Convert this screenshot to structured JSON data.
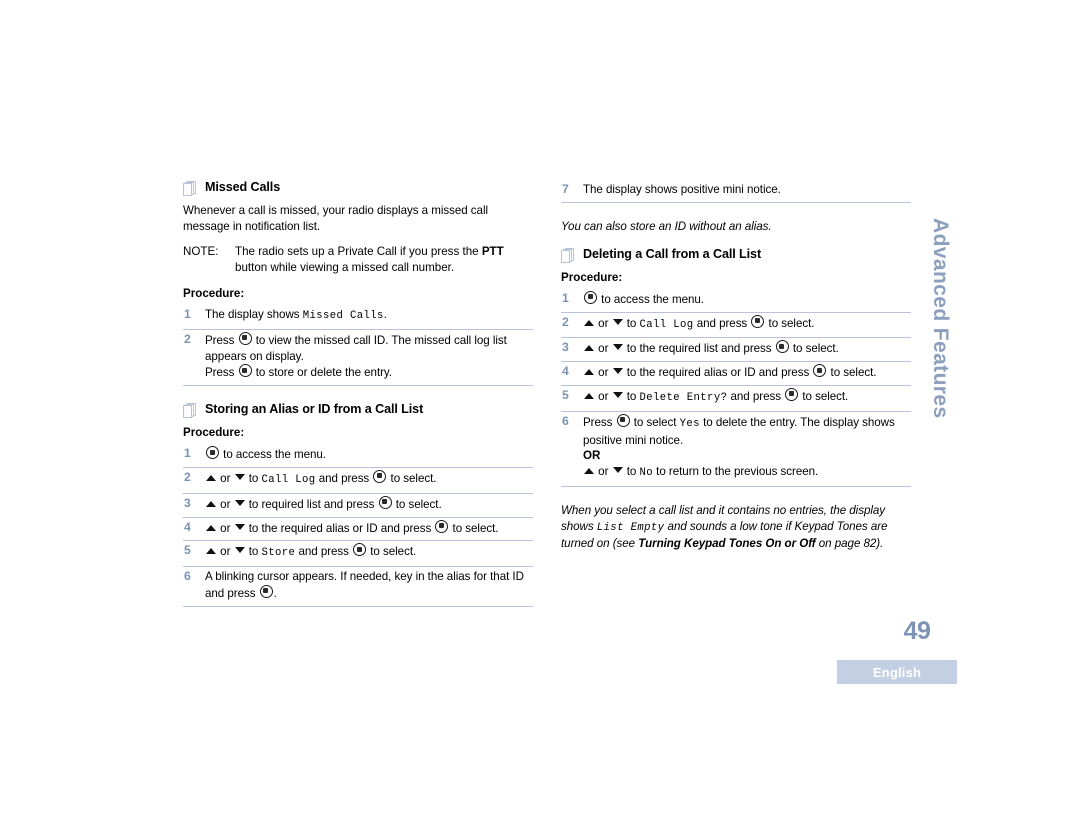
{
  "page": {
    "number": "49",
    "language_badge": "English",
    "chapter_tab": "Advanced Features"
  },
  "icons": {
    "section_bullet": "stacked-pages-icon",
    "menu_key": "round-menu-select-key-icon",
    "scroll_up": "triangle-up-icon",
    "scroll_down": "triangle-down-icon"
  },
  "colors": {
    "step_number": "#7c93b5",
    "separator": "#b9c2dc",
    "chapter_tab_text": "#8c9fbe",
    "badge_background": "#c3cfe2",
    "page_number": "#7d93b3"
  },
  "left_column": {
    "section_1": {
      "heading": "Missed Calls",
      "intro": "Whenever a call is missed, your radio displays a missed call message in notification list.",
      "note_label": "NOTE:",
      "note_text_a": "The radio sets up a Private Call if you press the ",
      "note_text_bold": "PTT",
      "note_text_b": " button while viewing a missed call number.",
      "procedure_label": "Procedure:",
      "steps": [
        {
          "number": "1",
          "a": "The display shows ",
          "mono": "Missed Calls",
          "b": "."
        },
        {
          "number": "2",
          "a": "Press ",
          "b": " to view the missed call ID. The missed call log list appears on display.",
          "c": "Press ",
          "d": " to store or delete the entry."
        }
      ]
    },
    "section_2": {
      "heading": "Storing an Alias or ID from a Call List",
      "procedure_label": "Procedure:",
      "steps": [
        {
          "number": "1",
          "a": " to access the menu."
        },
        {
          "number": "2",
          "a": " or ",
          "b": " to ",
          "mono": "Call Log",
          "c": " and press ",
          "d": " to select."
        },
        {
          "number": "3",
          "a": " or ",
          "b": " to required list and press ",
          "c": " to select."
        },
        {
          "number": "4",
          "a": " or ",
          "b": " to the required alias or ID and press ",
          "c": " to select."
        },
        {
          "number": "5",
          "a": " or ",
          "b": " to ",
          "mono": "Store",
          "c": " and press ",
          "d": " to select."
        },
        {
          "number": "6",
          "a": "A blinking cursor appears. If needed, key in the alias for that ID and press ",
          "b": "."
        }
      ]
    }
  },
  "right_column": {
    "continued_step": {
      "number": "7",
      "text": "The display shows positive mini notice."
    },
    "note_after": "You can also store an ID without an alias.",
    "section_3": {
      "heading": "Deleting a Call from a Call List",
      "procedure_label": "Procedure:",
      "steps": [
        {
          "number": "1",
          "a": " to access the menu."
        },
        {
          "number": "2",
          "a": " or ",
          "b": " to ",
          "mono": "Call Log",
          "c": " and press ",
          "d": " to select."
        },
        {
          "number": "3",
          "a": " or ",
          "b": " to the required list and press ",
          "c": " to select."
        },
        {
          "number": "4",
          "a": " or ",
          "b": " to the required alias or ID and press ",
          "c": " to select."
        },
        {
          "number": "5",
          "a": " or ",
          "b": " to ",
          "mono": "Delete Entry?",
          "c": " and press ",
          "d": " to select."
        },
        {
          "number": "6",
          "a": "Press ",
          "b": " to select ",
          "mono_yes": "Yes",
          "c": " to delete the entry. The display shows positive mini notice.",
          "or_label": "OR",
          "d": " or ",
          "e": " to ",
          "mono_no": "No",
          "f": " to return to the previous screen."
        }
      ]
    },
    "closing_note": {
      "a": "When you select a call list and it contains no entries, the display shows ",
      "mono": "List Empty",
      "b": " and sounds a low tone if Keypad Tones are turned on (see ",
      "bold_ref": "Turning Keypad Tones On or Off",
      "c": " on page 82)."
    }
  }
}
